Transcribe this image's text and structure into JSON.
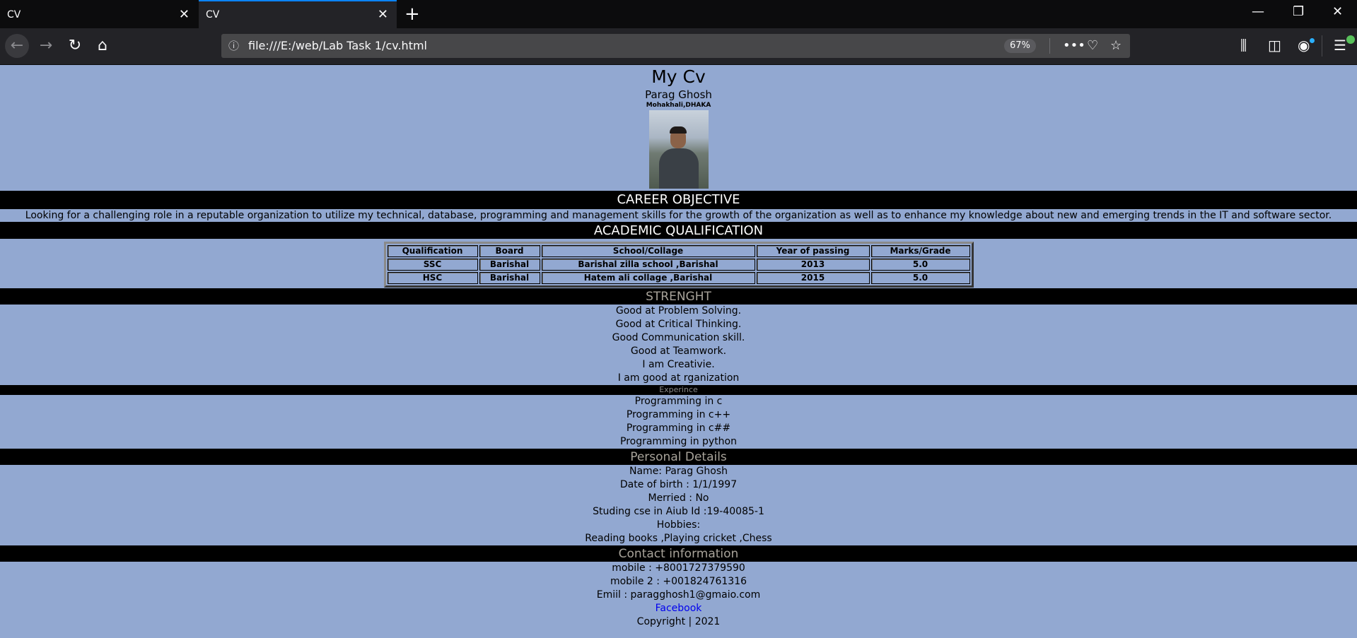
{
  "browser": {
    "tabs": [
      {
        "title": "CV",
        "active": false
      },
      {
        "title": "CV",
        "active": true
      }
    ],
    "url": "file:///E:/web/Lab Task 1/cv.html",
    "zoom": "67%",
    "icons": {
      "back": "arrow-left-icon",
      "forward": "arrow-right-icon",
      "reload": "reload-icon",
      "home": "home-icon",
      "info": "info-icon",
      "more": "more-icon",
      "pocket": "pocket-icon",
      "bookmark": "star-icon",
      "library": "library-icon",
      "sidebar": "sidebar-icon",
      "account": "account-icon",
      "menu": "menu-icon"
    }
  },
  "cv": {
    "title": "My Cv",
    "name": "Parag Ghosh",
    "address": "Mohakhali,DHAKA",
    "career_heading": "CAREER OBJECTIVE",
    "career_text": "Looking for a challenging role in a reputable organization to utilize my technical, database, programming and management skills for the growth of the organization as well as to enhance my knowledge about new and emerging trends in the IT and software sector.",
    "academic_heading": "ACADEMIC QUALIFICATION",
    "academic_table": {
      "headers": [
        "Qualification",
        "Board",
        "School/Collage",
        "Year of passing",
        "Marks/Grade"
      ],
      "rows": [
        [
          "SSC",
          "Barishal",
          "Barishal zilla school ,Barishal",
          "2013",
          "5.0"
        ],
        [
          "HSC",
          "Barishal",
          "Hatem ali collage ,Barishal",
          "2015",
          "5.0"
        ]
      ]
    },
    "strength_heading": "STRENGHT",
    "strengths": [
      "Good at Problem Solving.",
      "Good at Critical Thinking.",
      "Good Communication skill.",
      "Good at Teamwork.",
      "I am Creativie.",
      "I am good at rganization"
    ],
    "experience_heading": "Experince",
    "experience": [
      "Programming in c",
      "Programming in c++",
      "Programming in c##",
      "Programming in python"
    ],
    "personal_heading": "Personal Details",
    "personal": [
      "Name: Parag Ghosh",
      "Date of birth : 1/1/1997",
      "Merried : No",
      "Studing cse in Aiub Id :19-40085-1",
      "Hobbies:",
      "Reading books ,Playing cricket ,Chess"
    ],
    "contact_heading": "Contact information",
    "contact": [
      "mobile : +8001727379590",
      "mobile 2 : +001824761316",
      "Emiil : paragghosh1@gmaio.com"
    ],
    "facebook_label": "Facebook",
    "copyright": "Copyright | 2021"
  }
}
